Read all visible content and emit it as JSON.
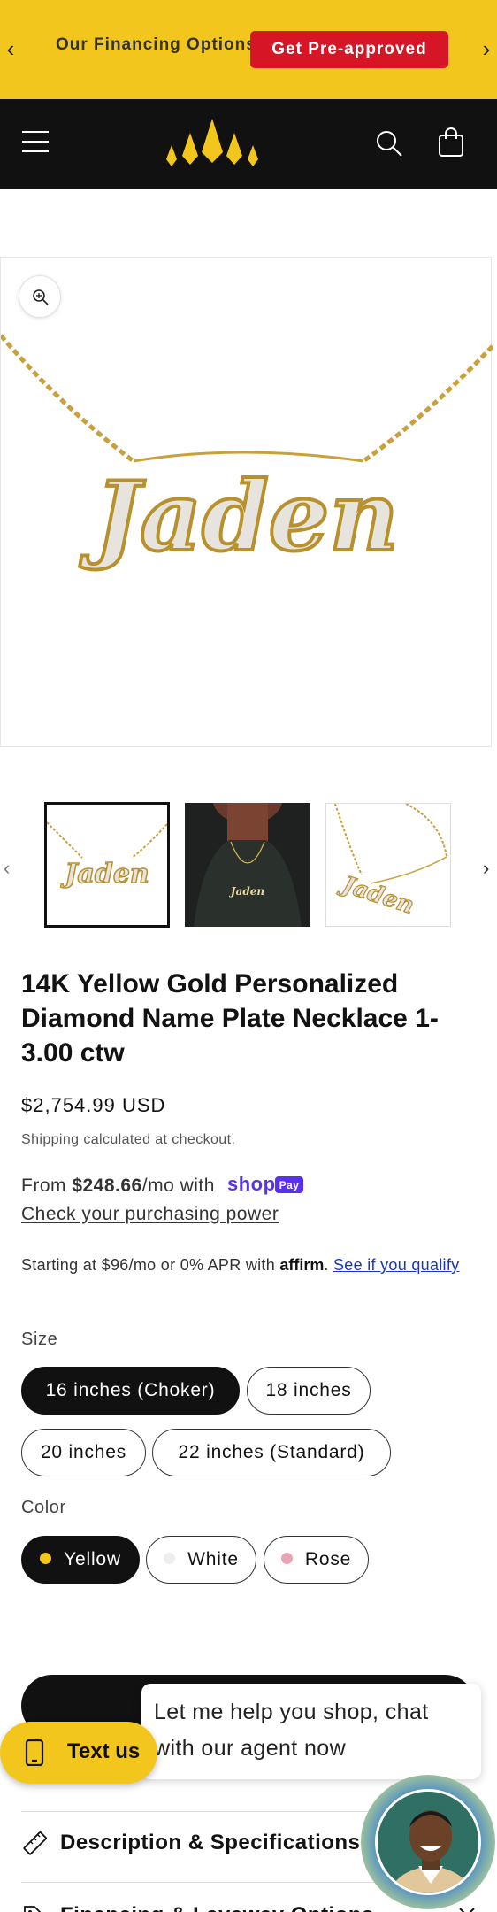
{
  "announcement": {
    "message": "Our Financing Options",
    "cta_label": "Get Pre-approved",
    "prev_glyph": "‹",
    "next_glyph": "›",
    "background_color": "#f3c61d",
    "cta_color": "#d61526"
  },
  "header": {
    "background_color": "#111111",
    "logo_color": "#f3c61d",
    "icons": [
      "menu-icon",
      "crown-logo",
      "search-icon",
      "cart-icon"
    ]
  },
  "gallery": {
    "prev_glyph": "‹",
    "next_glyph": "›",
    "main_image_text": "Jaden",
    "thumbnails": [
      "necklace-front",
      "necklace-worn",
      "necklace-angle"
    ]
  },
  "product": {
    "title": "14K Yellow Gold Personalized Diamond Name Plate Necklace 1-3.00 ctw",
    "price": "$2,754.99 USD",
    "shipping_link": "Shipping",
    "shipping_text": " calculated at checkout."
  },
  "shop_pay": {
    "prefix": "From ",
    "amount": "$248.66",
    "suffix": "/mo with",
    "brand": "shop",
    "badge": "Pay",
    "power_link": "Check your purchasing power",
    "brand_color": "#5a31f4"
  },
  "affirm": {
    "text": "Starting at $96/mo or 0% APR with ",
    "logo": "affirm",
    "period": ". ",
    "link": "See if you qualify"
  },
  "options": {
    "size_label": "Size",
    "sizes": [
      "16 inches (Choker)",
      "18 inches",
      "20 inches",
      "22 inches (Standard)"
    ],
    "selected_size": "16 inches (Choker)",
    "color_label": "Color",
    "colors": [
      {
        "name": "Yellow",
        "swatch": "#f3c61d"
      },
      {
        "name": "White",
        "swatch": "#eeeeee"
      },
      {
        "name": "Rose",
        "swatch": "#e8a3b4"
      }
    ],
    "selected_color": "Yellow"
  },
  "chat": {
    "bubble_text": "Let me help you shop, chat with our agent now",
    "text_us_label": "Text us"
  },
  "accordions": [
    {
      "label": "Description & Specifications",
      "icon": "ruler-icon"
    },
    {
      "label": "Financing & Layaway Options",
      "icon": "tag-icon"
    }
  ]
}
